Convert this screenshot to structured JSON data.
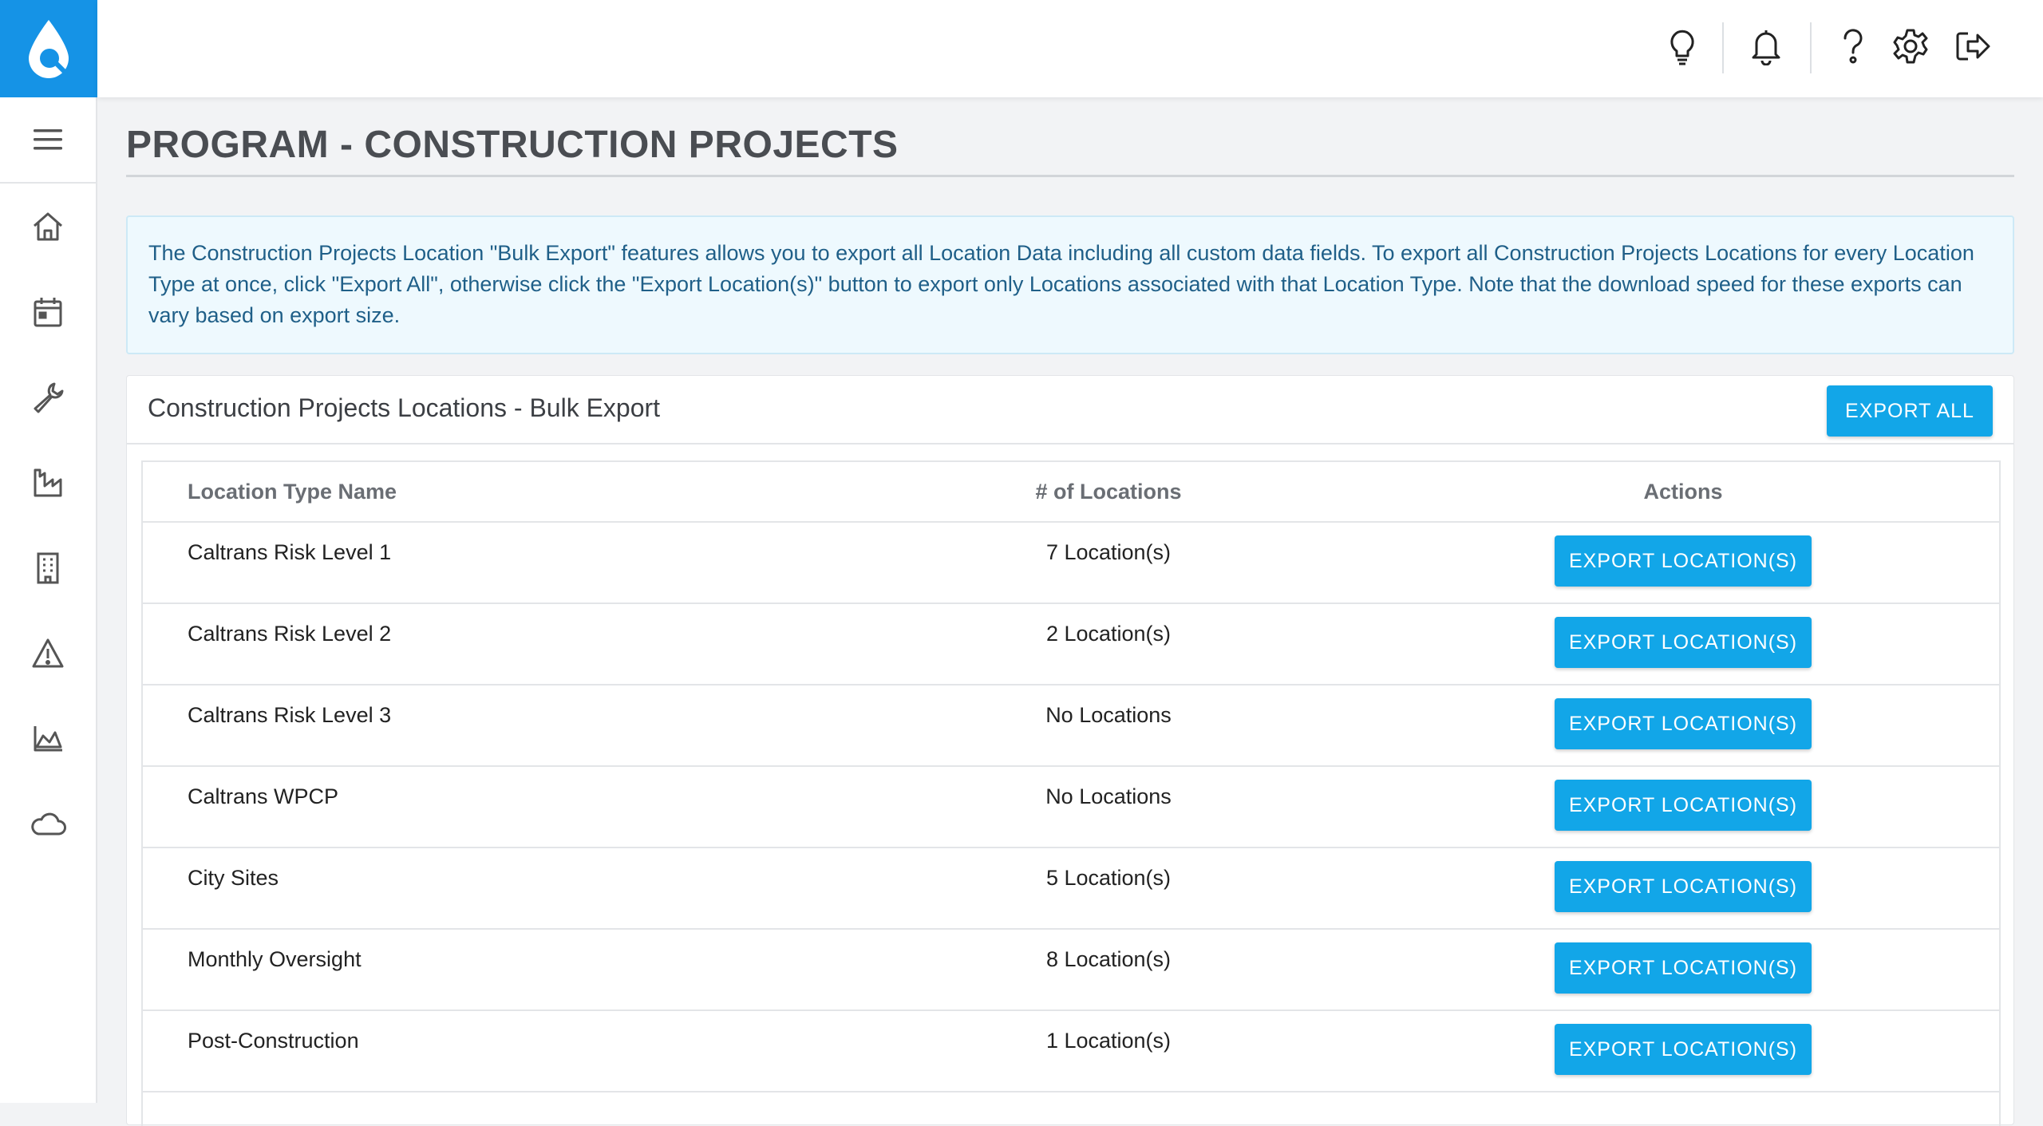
{
  "page": {
    "title": "PROGRAM - CONSTRUCTION PROJECTS"
  },
  "rail": {
    "items": [
      {
        "icon": "home-icon"
      },
      {
        "icon": "calendar-icon"
      },
      {
        "icon": "wrench-icon"
      },
      {
        "icon": "factory-icon"
      },
      {
        "icon": "building-icon"
      },
      {
        "icon": "warning-icon"
      },
      {
        "icon": "area-chart-icon"
      },
      {
        "icon": "cloud-icon"
      }
    ]
  },
  "topbar": {
    "icons": [
      "lightbulb-icon",
      "bell-icon",
      "help-icon",
      "gear-icon",
      "logout-icon"
    ]
  },
  "info": {
    "text": "The Construction Projects Location \"Bulk Export\" features allows you to export all Location Data including all custom data fields. To export all Construction Projects Locations for every Location Type at once, click \"Export All\", otherwise click the \"Export Location(s)\" button to export only Locations associated with that Location Type. Note that the download speed for these exports can vary based on export size."
  },
  "panel": {
    "title": "Construction Projects Locations - Bulk Export",
    "export_all_label": "EXPORT ALL"
  },
  "table": {
    "headers": {
      "name": "Location Type Name",
      "count": "# of Locations",
      "actions": "Actions"
    },
    "rows": [
      {
        "name": "Caltrans Risk Level 1",
        "count": "7 Location(s)",
        "action": "EXPORT LOCATION(S)"
      },
      {
        "name": "Caltrans Risk Level 2",
        "count": "2 Location(s)",
        "action": "EXPORT LOCATION(S)"
      },
      {
        "name": "Caltrans Risk Level 3",
        "count": "No Locations",
        "action": "EXPORT LOCATION(S)"
      },
      {
        "name": "Caltrans WPCP",
        "count": "No Locations",
        "action": "EXPORT LOCATION(S)"
      },
      {
        "name": "City Sites",
        "count": "5 Location(s)",
        "action": "EXPORT LOCATION(S)"
      },
      {
        "name": "Monthly Oversight",
        "count": "8 Location(s)",
        "action": "EXPORT LOCATION(S)"
      },
      {
        "name": "Post-Construction",
        "count": "1 Location(s)",
        "action": "EXPORT LOCATION(S)"
      }
    ]
  },
  "colors": {
    "brand": "#1593e6",
    "button": "#12a6e8",
    "info_bg": "#eef9fe",
    "info_text": "#1f5f88"
  }
}
